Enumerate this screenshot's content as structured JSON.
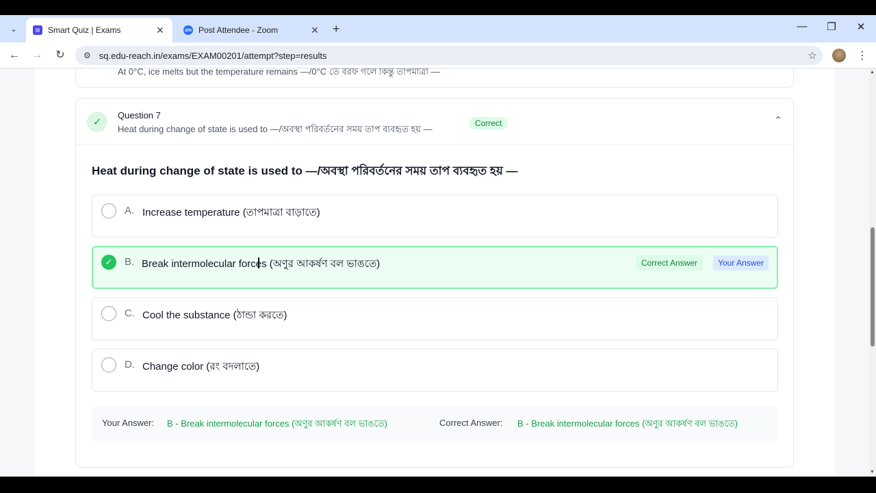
{
  "browser": {
    "tabs": [
      {
        "title": "Smart Quiz | Exams",
        "icon": "book-icon",
        "active": true
      },
      {
        "title": "Post Attendee - Zoom",
        "icon": "zoom-icon",
        "active": false
      }
    ],
    "url": "sq.edu-reach.in/exams/EXAM00201/attempt?step=results"
  },
  "previous_question": {
    "snippet": "At 0°C, ice melts but the temperature remains —/0°C তে বরফ গলে কিন্তু তাপমাত্রা —"
  },
  "question": {
    "number_label": "Question 7",
    "subtitle": "Heat during change of state is used to —/অবস্থা পরিবর্তনের সময় তাপ ব্যবহৃত হয় —",
    "status_badge": "Correct",
    "title": "Heat during change of state is used to —/অবস্থা পরিবর্তনের সময় তাপ ব্যবহৃত হয় —",
    "options": [
      {
        "letter": "A.",
        "text": "Increase temperature (তাপমাত্রা বাড়াতে)",
        "state": "none"
      },
      {
        "letter": "B.",
        "text": "Break intermolecular forces (অণুর আকর্ষণ বল ভাঙতে)",
        "state": "correct"
      },
      {
        "letter": "C.",
        "text": "Cool the substance (ঠান্ডা করতে)",
        "state": "none"
      },
      {
        "letter": "D.",
        "text": "Change color (রং বদলাতে)",
        "state": "none"
      }
    ],
    "correct_tag": "Correct Answer",
    "your_tag": "Your Answer",
    "summary": {
      "your_label": "Your Answer:",
      "your_value": "B - Break intermolecular forces (অণুর আকর্ষণ বল ভাঙতে)",
      "correct_label": "Correct Answer:",
      "correct_value": "B - Break intermolecular forces (অণুর আকর্ষণ বল ভাঙতে)"
    }
  },
  "overlay": {
    "watermark": "zoom"
  },
  "colors": {
    "accent_green": "#16a34a",
    "tabstrip": "#d3e3fd"
  }
}
